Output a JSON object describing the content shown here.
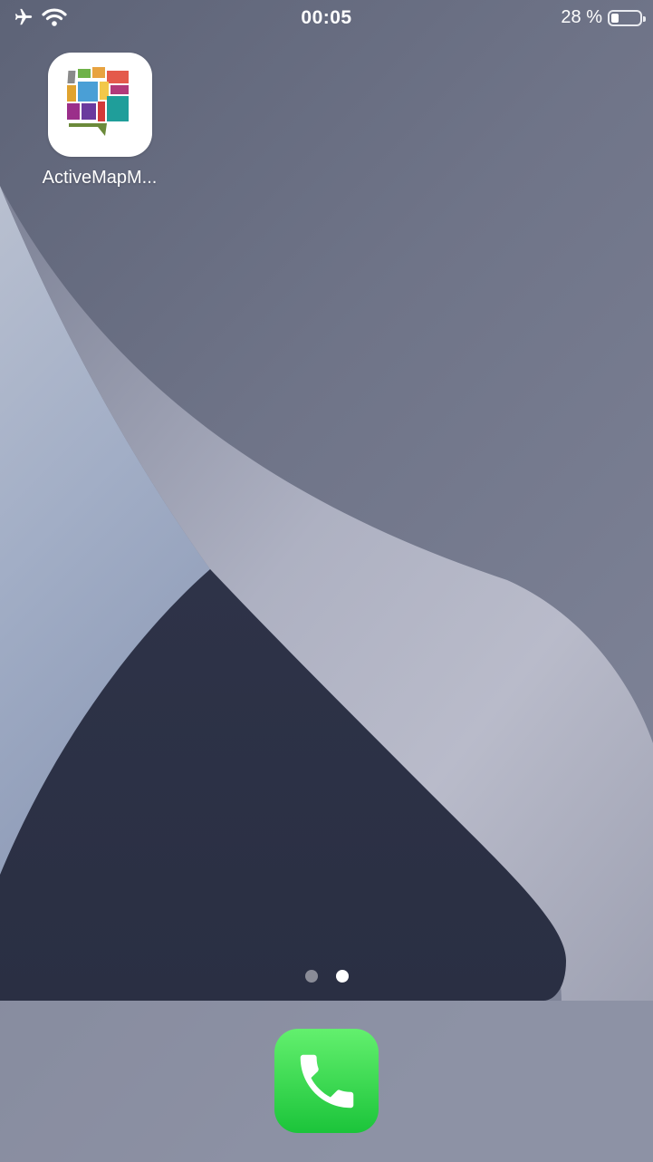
{
  "status_bar": {
    "airplane_icon": "airplane-icon",
    "wifi_icon": "wifi-icon",
    "time": "00:05",
    "battery_percent": "28 %",
    "battery_level": 0.28
  },
  "home": {
    "apps": [
      {
        "label": "ActiveMapM...",
        "icon": "activemap-app-icon"
      }
    ],
    "pages": {
      "count": 2,
      "current": 2
    }
  },
  "dock": {
    "apps": [
      {
        "icon": "phone-icon",
        "color": "#2bd44f"
      }
    ]
  },
  "colors": {
    "wallpaper_light": "#b6b8c8",
    "wallpaper_dark": "#2b3044",
    "wallpaper_blue": "#9aa6c0"
  }
}
